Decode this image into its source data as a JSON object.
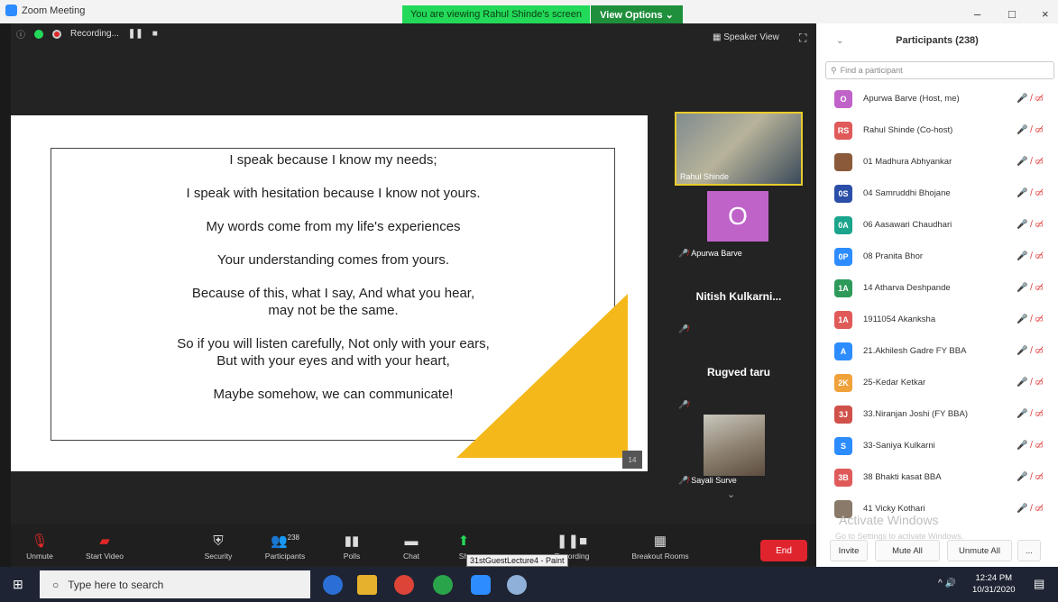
{
  "window": {
    "title": "Zoom Meeting",
    "banner": "You are viewing Rahul Shinde's screen",
    "view_options": "View Options ⌄",
    "controls": [
      "–",
      "□",
      "×"
    ]
  },
  "top_bar": {
    "recording_label": "Recording...",
    "speaker_view": "Speaker View"
  },
  "slide": {
    "lines": [
      "I speak because I know my needs;",
      "I speak with hesitation because I know not yours.",
      "My words come from my life's experiences",
      "Your understanding comes from yours.",
      "Because of this, what I say, And what you hear,\nmay not be the same.",
      "So if you will listen carefully, Not only with your ears,\nBut with your eyes and with your heart,",
      "Maybe somehow, we can communicate!"
    ],
    "page_number": "14",
    "accent_color": "#f4b81a"
  },
  "video_tiles": {
    "rahul": "Rahul Shinde",
    "apurwa_initial": "O",
    "apurwa": "Apurwa Barve",
    "nitish": "Nitish  Kulkarni...",
    "rugved": "Rugved taru",
    "sayali": "Sayali Surve"
  },
  "toolbar": {
    "unmute": "Unmute",
    "start_video": "Start Video",
    "security": "Security",
    "participants": "Participants",
    "participants_count": "238",
    "polls": "Polls",
    "chat": "Chat",
    "share": "Sh",
    "recording": "Recording",
    "breakout": "Breakout Rooms",
    "end": "End",
    "tooltip": "31stGuestLecture4 - Paint"
  },
  "participants_panel": {
    "title": "Participants (238)",
    "search_placeholder": "Find a participant",
    "rows": [
      {
        "initials": "O",
        "color": "#c063c9",
        "name": "Apurwa Barve (Host, me)"
      },
      {
        "initials": "RS",
        "color": "#e05a5a",
        "name": "Rahul Shinde (Co-host)"
      },
      {
        "initials": "",
        "color": "#8a5a3a",
        "name": "01 Madhura Abhyankar"
      },
      {
        "initials": "0S",
        "color": "#2b4fa8",
        "name": "04 Samruddhi Bhojane"
      },
      {
        "initials": "0A",
        "color": "#1aa58c",
        "name": "06 Aasawari Chaudhari"
      },
      {
        "initials": "0P",
        "color": "#2d8cff",
        "name": "08 Pranita Bhor"
      },
      {
        "initials": "1A",
        "color": "#2e9a5a",
        "name": "14 Atharva Deshpande"
      },
      {
        "initials": "1A",
        "color": "#e05a5a",
        "name": "1911054 Akanksha"
      },
      {
        "initials": "A",
        "color": "#2d8cff",
        "name": "21.Akhilesh Gadre FY BBA"
      },
      {
        "initials": "2K",
        "color": "#f0a23a",
        "name": "25-Kedar Ketkar"
      },
      {
        "initials": "3J",
        "color": "#d0504a",
        "name": "33.Niranjan Joshi (FY BBA)"
      },
      {
        "initials": "S",
        "color": "#2d8cff",
        "name": "33-Saniya Kulkarni"
      },
      {
        "initials": "3B",
        "color": "#e05a5a",
        "name": "38 Bhakti kasat BBA"
      },
      {
        "initials": "",
        "color": "#8a7a6a",
        "name": "41 Vicky Kothari"
      }
    ],
    "invite": "Invite",
    "mute_all": "Mute All",
    "unmute_all": "Unmute All",
    "more": "...",
    "watermark_title": "Activate Windows",
    "watermark_sub": "Go to Settings to activate Windows."
  },
  "taskbar": {
    "search_placeholder": "Type here to search",
    "time": "12:24 PM",
    "date": "10/31/2020"
  }
}
